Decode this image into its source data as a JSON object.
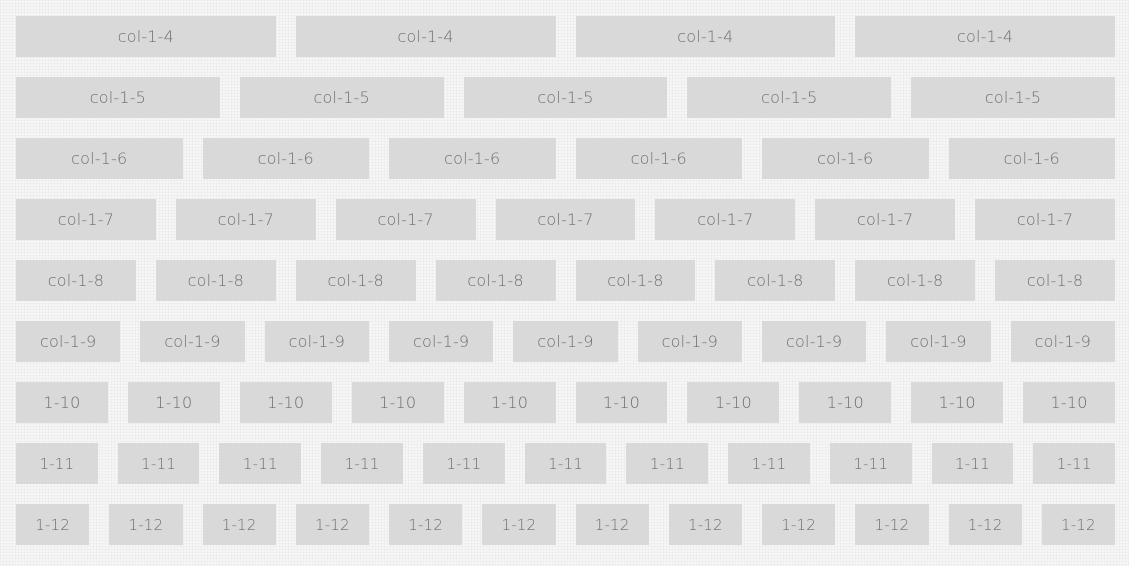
{
  "colors": {
    "background": "#f6f6f6",
    "cell_background": "#d9d9d9",
    "cell_text": "#6e6e6e"
  },
  "grid": {
    "rows": [
      {
        "id": "1-4",
        "cells": [
          "col-1-4",
          "col-1-4",
          "col-1-4",
          "col-1-4"
        ]
      },
      {
        "id": "1-5",
        "cells": [
          "col-1-5",
          "col-1-5",
          "col-1-5",
          "col-1-5",
          "col-1-5"
        ]
      },
      {
        "id": "1-6",
        "cells": [
          "col-1-6",
          "col-1-6",
          "col-1-6",
          "col-1-6",
          "col-1-6",
          "col-1-6"
        ]
      },
      {
        "id": "1-7",
        "cells": [
          "col-1-7",
          "col-1-7",
          "col-1-7",
          "col-1-7",
          "col-1-7",
          "col-1-7",
          "col-1-7"
        ]
      },
      {
        "id": "1-8",
        "cells": [
          "col-1-8",
          "col-1-8",
          "col-1-8",
          "col-1-8",
          "col-1-8",
          "col-1-8",
          "col-1-8",
          "col-1-8"
        ]
      },
      {
        "id": "1-9",
        "cells": [
          "col-1-9",
          "col-1-9",
          "col-1-9",
          "col-1-9",
          "col-1-9",
          "col-1-9",
          "col-1-9",
          "col-1-9",
          "col-1-9"
        ]
      },
      {
        "id": "1-10",
        "cells": [
          "1-10",
          "1-10",
          "1-10",
          "1-10",
          "1-10",
          "1-10",
          "1-10",
          "1-10",
          "1-10",
          "1-10"
        ]
      },
      {
        "id": "1-11",
        "cells": [
          "1-11",
          "1-11",
          "1-11",
          "1-11",
          "1-11",
          "1-11",
          "1-11",
          "1-11",
          "1-11",
          "1-11",
          "1-11"
        ]
      },
      {
        "id": "1-12",
        "cells": [
          "1-12",
          "1-12",
          "1-12",
          "1-12",
          "1-12",
          "1-12",
          "1-12",
          "1-12",
          "1-12",
          "1-12",
          "1-12",
          "1-12"
        ]
      }
    ]
  }
}
